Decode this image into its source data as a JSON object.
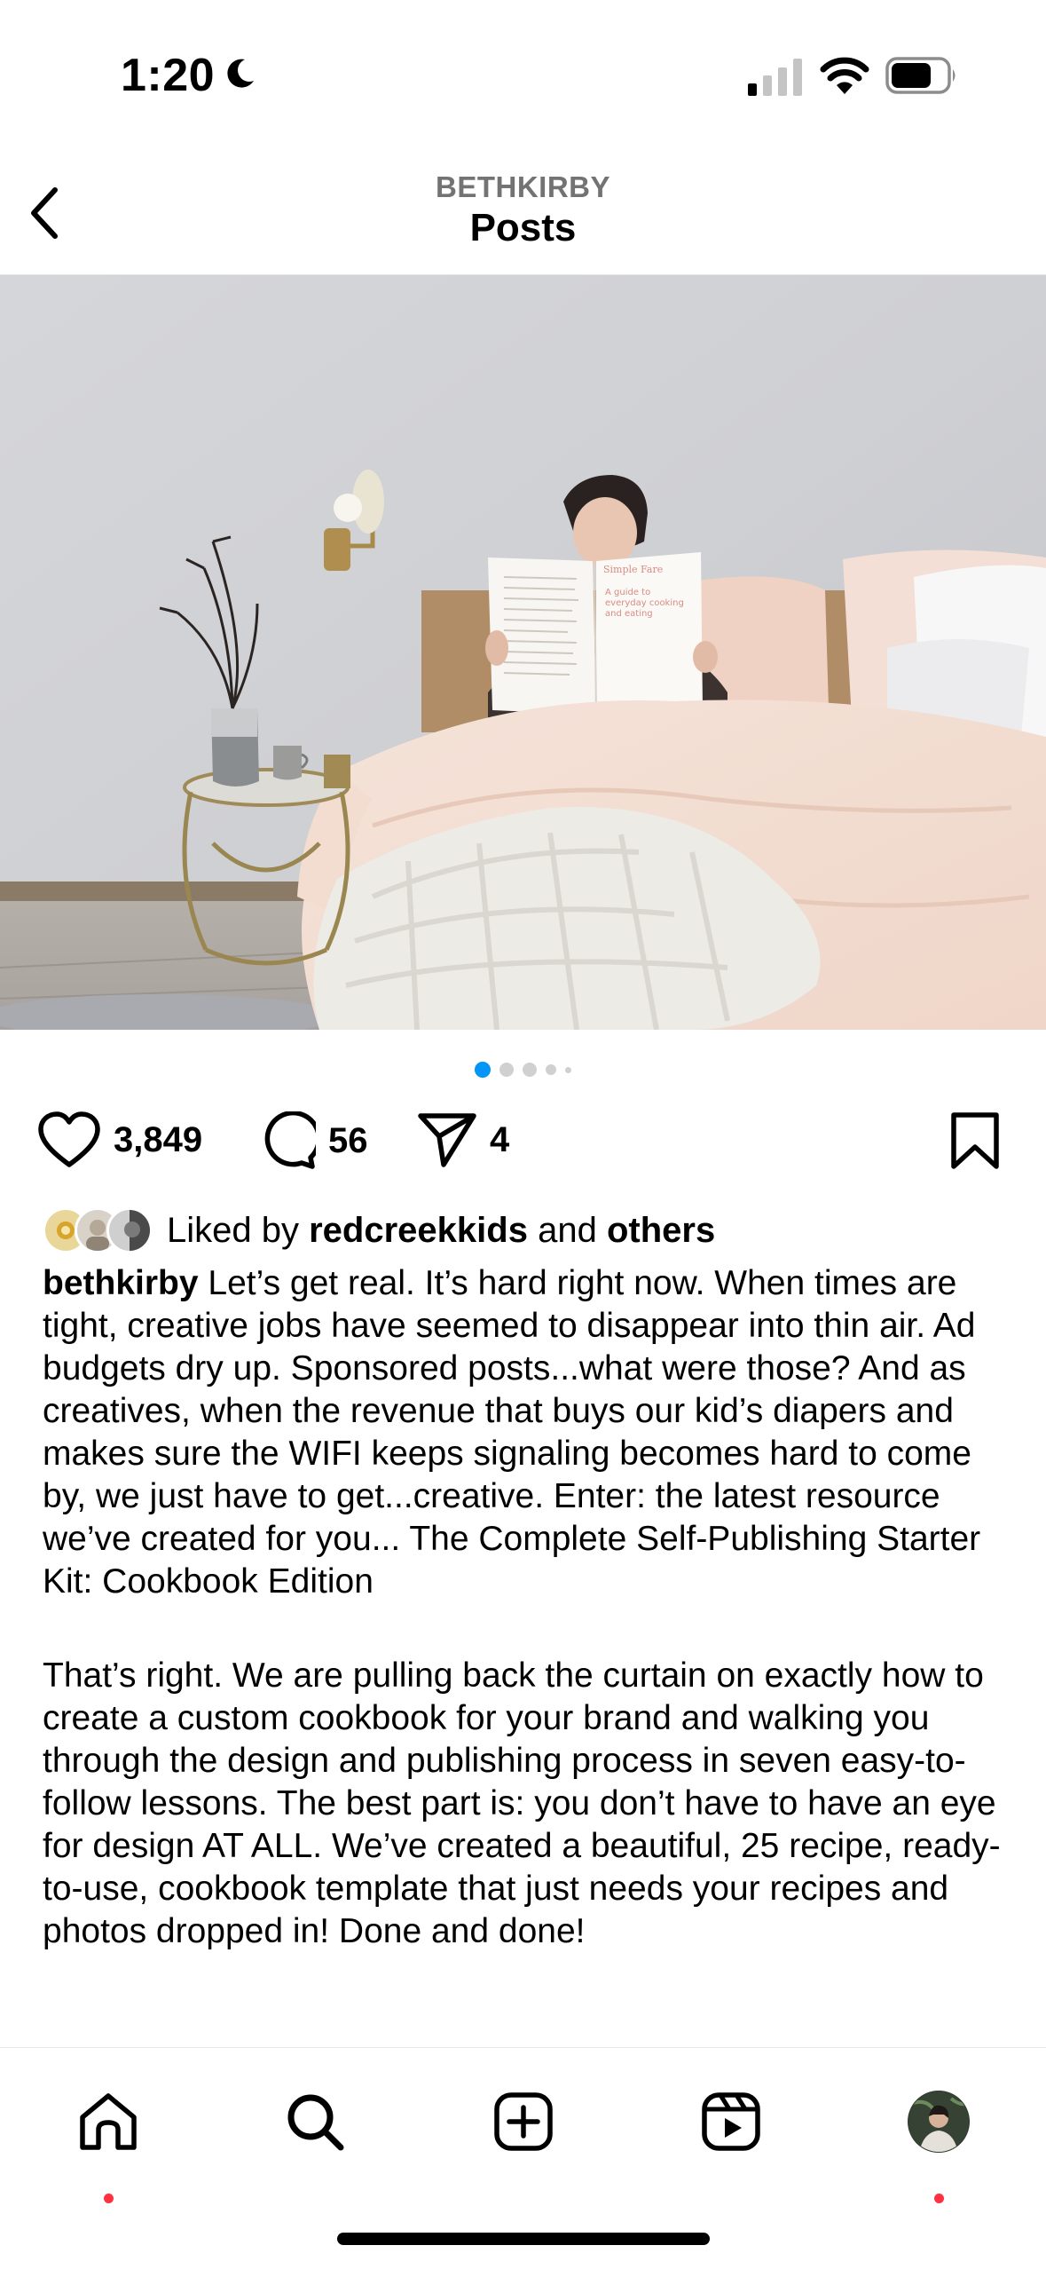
{
  "status_bar": {
    "time": "1:20",
    "icons": [
      "moon-icon",
      "cellular-signal-icon",
      "wifi-icon",
      "battery-icon"
    ]
  },
  "header": {
    "username": "BETHKIRBY",
    "title": "Posts",
    "back_icon": "chevron-left-icon"
  },
  "post": {
    "carousel": {
      "total": 5,
      "active_index": 0,
      "active_color": "#0095f6"
    },
    "actions": {
      "like_count": "3,849",
      "comment_count": "56",
      "share_count": "4",
      "icons": [
        "heart-icon",
        "comment-icon",
        "share-icon",
        "bookmark-icon"
      ]
    },
    "liked_by": {
      "prefix": "Liked by",
      "user": "redcreekkids",
      "joiner": "and",
      "others": "others"
    },
    "caption": {
      "username": "bethkirby",
      "paragraph1": "Let’s get real. It’s hard right now. When times are tight, creative jobs have seemed to disappear into thin air. Ad budgets dry up. Sponsored posts...what were those? And as creatives, when the revenue that buys our kid’s diapers and makes sure the WIFI keeps signaling becomes hard to come by, we just have to get...creative. Enter: the latest resource we’ve created for you... The Complete Self-Publishing Starter Kit: Cookbook Edition",
      "paragraph2": "That’s right. We are pulling back the curtain on exactly how to create a custom cookbook for your brand and walking you through the design and publishing process in seven easy-to-follow lessons. The best part is: you don’t have to have an eye for design AT ALL. We’ve created a beautiful, 25 recipe, ready-to-use, cookbook template that just needs your recipes and photos dropped in! Done and done!"
    },
    "photo_book_text": {
      "title": "Simple Fare",
      "subtitle": "A guide to everyday cooking and eating"
    }
  },
  "tab_bar": {
    "tabs": [
      {
        "name": "home",
        "icon": "home-icon",
        "notification": true
      },
      {
        "name": "search",
        "icon": "search-icon",
        "notification": false
      },
      {
        "name": "create",
        "icon": "plus-square-icon",
        "notification": false
      },
      {
        "name": "reels",
        "icon": "reels-icon",
        "notification": false
      },
      {
        "name": "profile",
        "icon": "profile-avatar",
        "notification": true
      }
    ]
  },
  "colors": {
    "notification_dot": "#ff3040",
    "secondary_text": "#737373",
    "active_dot": "#0095f6"
  }
}
